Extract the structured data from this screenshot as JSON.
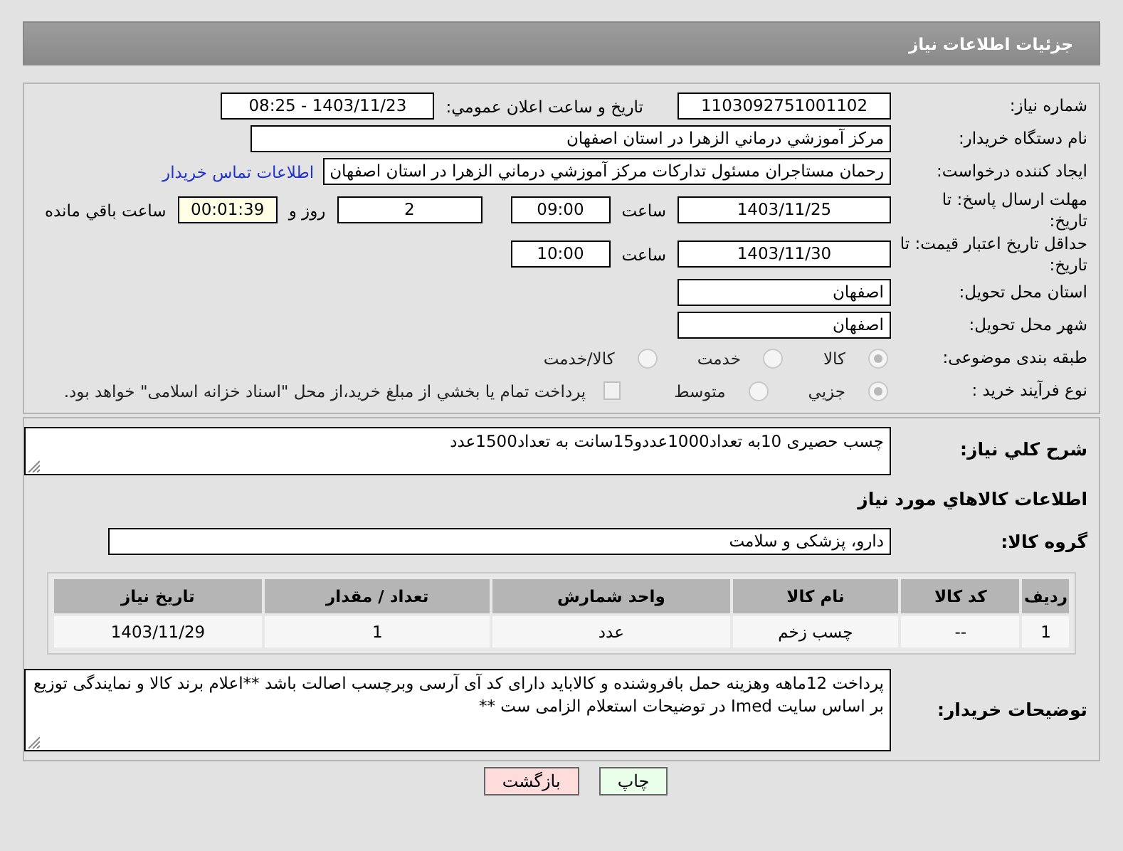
{
  "header": {
    "title": "جزئیات اطلاعات نیاز"
  },
  "need_number": {
    "label": "شماره نیاز:",
    "value": "1103092751001102"
  },
  "announce": {
    "label": "تاريخ و ساعت اعلان عمومي:",
    "value": "1403/11/23 - 08:25"
  },
  "buyer": {
    "label": "نام دستگاه خريدار:",
    "value": "مرکز آموزشي درماني الزهرا در استان اصفهان"
  },
  "requester": {
    "label": "ايجاد كننده درخواست:",
    "value": "رحمان مستاجران مسئول تداركات مركز آموزشي درماني الزهرا در استان اصفهان",
    "link": "اطلاعات تماس خريدار"
  },
  "reply_deadline": {
    "label": "مهلت ارسال پاسخ: تا تاریخ:",
    "date": "1403/11/25",
    "time_label": "ساعت",
    "time": "09:00",
    "days": "2",
    "days_label": "روز و",
    "remaining": "00:01:39",
    "remaining_label": "ساعت باقي مانده"
  },
  "price_validity": {
    "label": "حداقل تاريخ اعتبار قيمت: تا تاریخ:",
    "date": "1403/11/30",
    "time_label": "ساعت",
    "time": "10:00"
  },
  "province": {
    "label": "استان محل تحویل:",
    "value": "اصفهان"
  },
  "city": {
    "label": "شهر محل تحویل:",
    "value": "اصفهان"
  },
  "category": {
    "label": "طبقه بندی موضوعی:",
    "options": [
      {
        "label": "كالا",
        "selected": true
      },
      {
        "label": "خدمت",
        "selected": false
      },
      {
        "label": "كالا/خدمت",
        "selected": false
      }
    ]
  },
  "purchase_type": {
    "label": "نوع فرآیند خرید :",
    "options": [
      {
        "label": "جزيي",
        "selected": true
      },
      {
        "label": "متوسط",
        "selected": false
      }
    ],
    "payment": {
      "label": "پرداخت تمام يا بخشي از مبلغ خريد،از محل \"اسناد خزانه اسلامی\" خواهد بود.",
      "checked": false
    }
  },
  "description": {
    "label": "شرح كلي نياز:",
    "value": "چسب حصیری 10به تعداد1000عددو15سانت به تعداد1500عدد"
  },
  "goods_heading": "اطلاعات كالاهاي مورد نياز",
  "goods_group": {
    "label": "گروه كالا:",
    "value": "دارو، پزشکی و سلامت"
  },
  "table": {
    "columns": [
      "رديف",
      "كد كالا",
      "نام كالا",
      "واحد شمارش",
      "تعداد / مقدار",
      "تاريخ نياز"
    ],
    "rows": [
      [
        "1",
        "--",
        "چسب زخم",
        "عدد",
        "1",
        "1403/11/29"
      ]
    ]
  },
  "buyer_notes": {
    "label": "توضیحات خریدار:",
    "value": "پرداخت 12ماهه وهزینه حمل بافروشنده و کالاباید دارای کد آی آرسی وبرچسب اصالت باشد **اعلام برند کالا و نمایندگی توزیع بر اساس سایت Imed در توضیحات استعلام الزامی ست **"
  },
  "buttons": [
    {
      "label": "چاپ",
      "kind": "print"
    },
    {
      "label": "بازگشت",
      "kind": "back"
    }
  ]
}
